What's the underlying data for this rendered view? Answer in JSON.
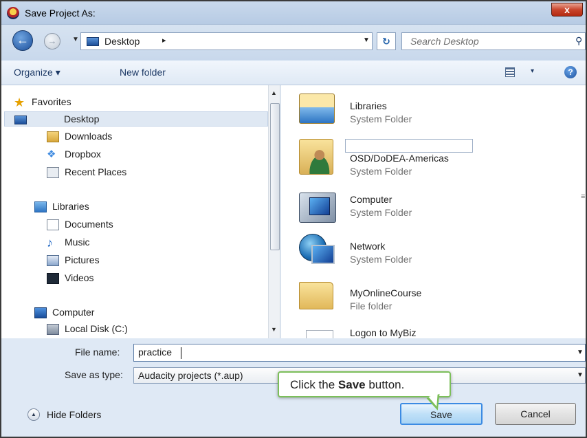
{
  "window": {
    "title": "Save Project As:",
    "close_label": "x"
  },
  "address_bar": {
    "location": "Desktop",
    "path_arrow": "▸",
    "search_placeholder": "Search Desktop"
  },
  "toolbar": {
    "organize_label": "Organize ▾",
    "new_folder_label": "New folder",
    "view_dropdown": "▾",
    "help_label": "?"
  },
  "nav_pane": {
    "favorites": [
      "Favorites",
      "Desktop",
      "Downloads",
      "Dropbox",
      "Recent Places"
    ],
    "libraries": [
      "Libraries",
      "Documents",
      "Music",
      "Pictures",
      "Videos"
    ],
    "computer": [
      "Computer",
      "Local Disk (C:)"
    ],
    "selected": "Desktop"
  },
  "files": [
    {
      "name": "Libraries",
      "type": "System Folder",
      "icon": "libraries-icon"
    },
    {
      "name": "OSD/DoDEA-Americas",
      "type": "System Folder",
      "icon": "user-folder-icon"
    },
    {
      "name": "Computer",
      "type": "System Folder",
      "icon": "computer-icon"
    },
    {
      "name": "Network",
      "type": "System Folder",
      "icon": "network-icon"
    },
    {
      "name": "MyOnlineCourse",
      "type": "File folder",
      "icon": "folder-icon"
    },
    {
      "name": "Logon to MyBiz",
      "type": "",
      "icon": "document-icon"
    }
  ],
  "form": {
    "file_name_label": "File name:",
    "file_name_value": "practice",
    "save_type_label": "Save as type:",
    "save_type_value": "Audacity projects (*.aup)"
  },
  "buttons": {
    "hide_folders": "Hide Folders",
    "save": "Save",
    "cancel": "Cancel"
  },
  "callout": {
    "prefix": "Click the ",
    "bold": "Save",
    "suffix": " button."
  },
  "colors": {
    "accent": "#3c8be3",
    "callout_border": "#7cbf5a",
    "close_red": "#c9452c"
  }
}
